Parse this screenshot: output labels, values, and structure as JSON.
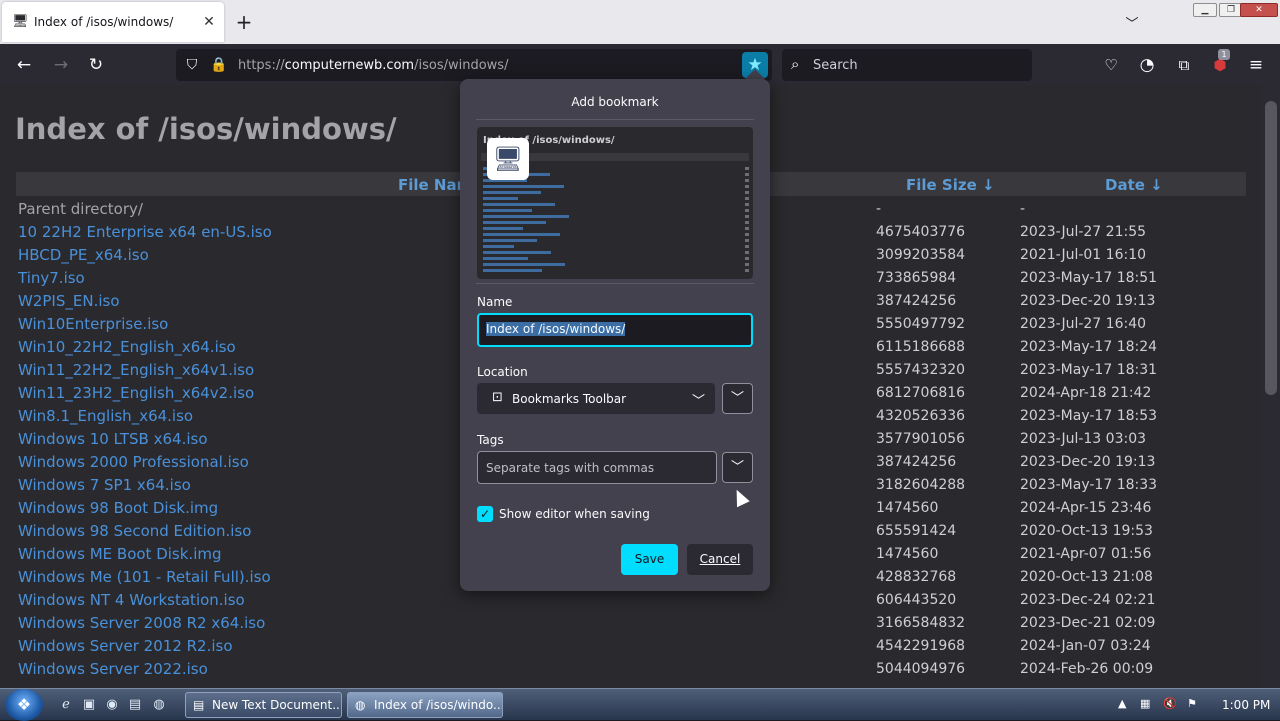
{
  "tab": {
    "title": "Index of /isos/windows/",
    "close_glyph": "✕",
    "new_glyph": "+"
  },
  "url": {
    "prefix": "https://",
    "host": "computernewb.com",
    "path": "/isos/windows/"
  },
  "search": {
    "placeholder": "Search"
  },
  "extension_badge": "1",
  "page": {
    "title": "Index of /isos/windows/",
    "columns": {
      "name": "File Nam",
      "size": "File Size  ↓",
      "date": "Date  ↓"
    },
    "rows": [
      {
        "name": "Parent directory/",
        "size": "-",
        "date": "-"
      },
      {
        "name": "10 22H2 Enterprise x64 en-US.iso",
        "size": "4675403776",
        "date": "2023-Jul-27 21:55"
      },
      {
        "name": "HBCD_PE_x64.iso",
        "size": "3099203584",
        "date": "2021-Jul-01 16:10"
      },
      {
        "name": "Tiny7.iso",
        "size": "733865984",
        "date": "2023-May-17 18:51"
      },
      {
        "name": "W2PIS_EN.iso",
        "size": "387424256",
        "date": "2023-Dec-20 19:13"
      },
      {
        "name": "Win10Enterprise.iso",
        "size": "5550497792",
        "date": "2023-Jul-27 16:40"
      },
      {
        "name": "Win10_22H2_English_x64.iso",
        "size": "6115186688",
        "date": "2023-May-17 18:24"
      },
      {
        "name": "Win11_22H2_English_x64v1.iso",
        "size": "5557432320",
        "date": "2023-May-17 18:31"
      },
      {
        "name": "Win11_23H2_English_x64v2.iso",
        "size": "6812706816",
        "date": "2024-Apr-18 21:42"
      },
      {
        "name": "Win8.1_English_x64.iso",
        "size": "4320526336",
        "date": "2023-May-17 18:53"
      },
      {
        "name": "Windows 10 LTSB x64.iso",
        "size": "3577901056",
        "date": "2023-Jul-13 03:03"
      },
      {
        "name": "Windows 2000 Professional.iso",
        "size": "387424256",
        "date": "2023-Dec-20 19:13"
      },
      {
        "name": "Windows 7 SP1 x64.iso",
        "size": "3182604288",
        "date": "2023-May-17 18:33"
      },
      {
        "name": "Windows 98 Boot Disk.img",
        "size": "1474560",
        "date": "2024-Apr-15 23:46"
      },
      {
        "name": "Windows 98 Second Edition.iso",
        "size": "655591424",
        "date": "2020-Oct-13 19:53"
      },
      {
        "name": "Windows ME Boot Disk.img",
        "size": "1474560",
        "date": "2021-Apr-07 01:56"
      },
      {
        "name": "Windows Me (101 - Retail Full).iso",
        "size": "428832768",
        "date": "2020-Oct-13 21:08"
      },
      {
        "name": "Windows NT 4 Workstation.iso",
        "size": "606443520",
        "date": "2023-Dec-24 02:21"
      },
      {
        "name": "Windows Server 2008 R2 x64.iso",
        "size": "3166584832",
        "date": "2023-Dec-21 02:09"
      },
      {
        "name": "Windows Server 2012 R2.iso",
        "size": "4542291968",
        "date": "2024-Jan-07 03:24"
      },
      {
        "name": "Windows Server 2022.iso",
        "size": "5044094976",
        "date": "2024-Feb-26 00:09"
      }
    ]
  },
  "bookmark_panel": {
    "title": "Add bookmark",
    "preview_title": "Index of /isos/windows/",
    "name_label": "Name",
    "name_value": "Index of /isos/windows/",
    "location_label": "Location",
    "location_value": "Bookmarks Toolbar",
    "tags_label": "Tags",
    "tags_placeholder": "Separate tags with commas",
    "show_editor_label": "Show editor when saving",
    "show_editor_checked": true,
    "save_label": "Save",
    "cancel_label": "Cancel"
  },
  "taskbar": {
    "tasks": [
      {
        "label": "New Text Document....",
        "active": false
      },
      {
        "label": "Index of /isos/windo...",
        "active": true
      }
    ],
    "clock": "1:00 PM"
  },
  "colors": {
    "accent": "#00ddff",
    "link": "#4a90d9",
    "panel": "#42414d",
    "page_bg": "#2a2a2e"
  }
}
